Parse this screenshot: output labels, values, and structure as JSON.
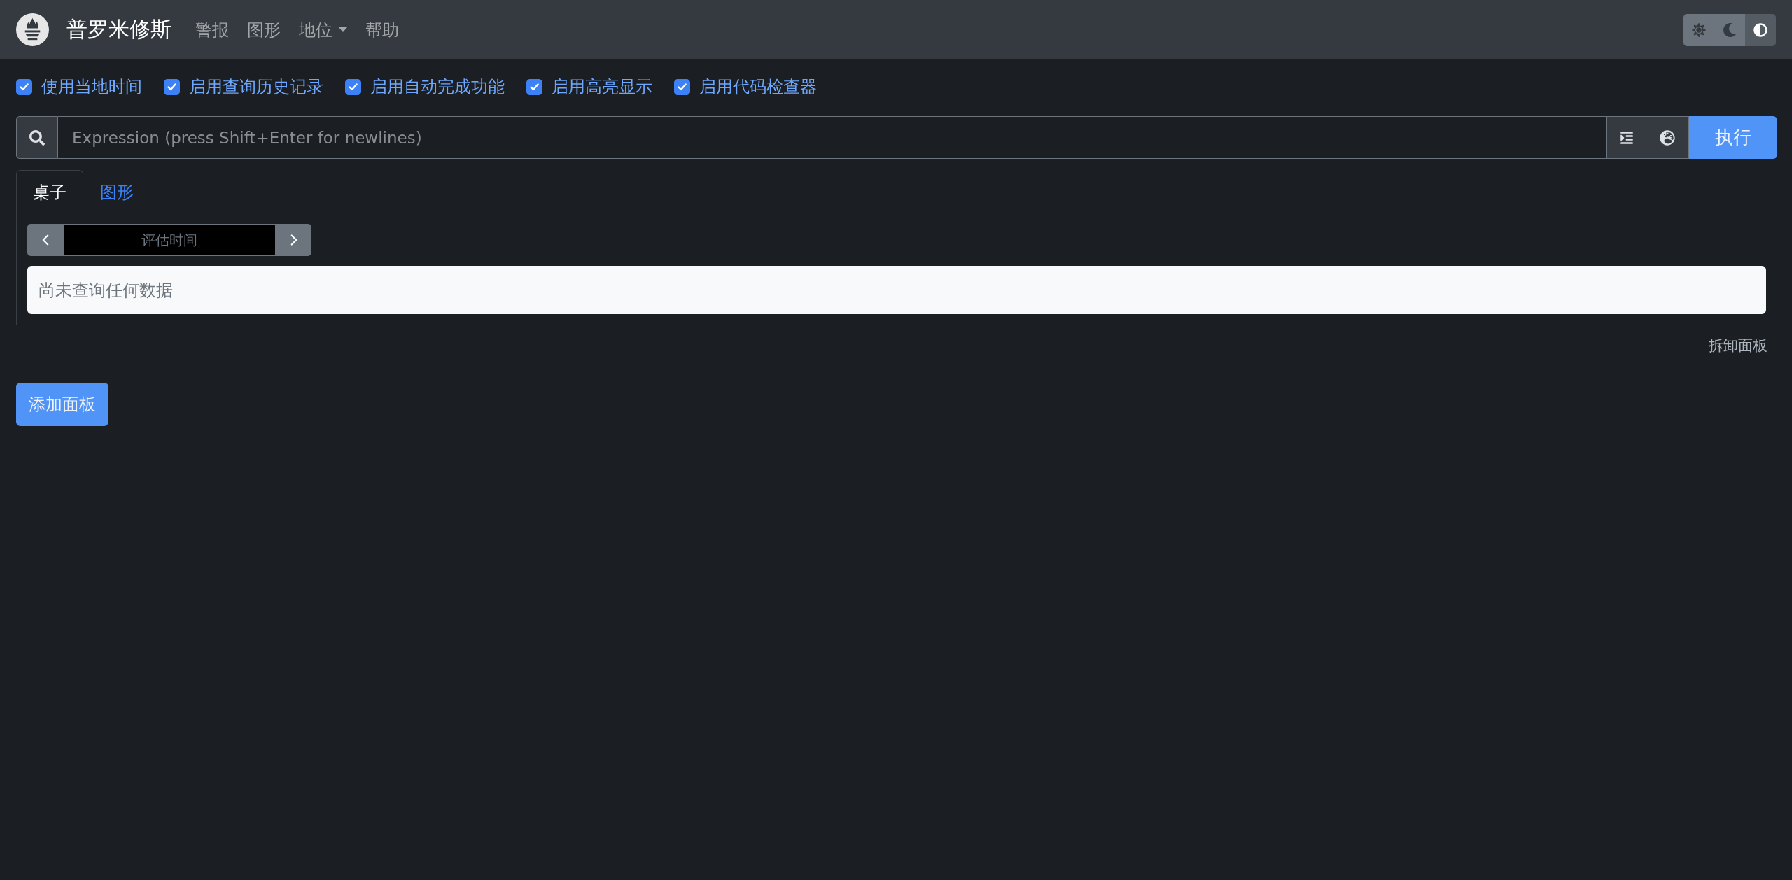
{
  "navbar": {
    "brand": "普罗米修斯",
    "links": [
      {
        "label": "警报",
        "dropdown": false
      },
      {
        "label": "图形",
        "dropdown": false
      },
      {
        "label": "地位",
        "dropdown": true
      },
      {
        "label": "帮助",
        "dropdown": false
      }
    ],
    "theme_toggle": [
      {
        "kind": "light",
        "selected": false
      },
      {
        "kind": "dark",
        "selected": false
      },
      {
        "kind": "auto",
        "selected": true
      }
    ]
  },
  "options": [
    {
      "label": "使用当地时间",
      "checked": true
    },
    {
      "label": "启用查询历史记录",
      "checked": true
    },
    {
      "label": "启用自动完成功能",
      "checked": true
    },
    {
      "label": "启用高亮显示",
      "checked": true
    },
    {
      "label": "启用代码检查器",
      "checked": true
    }
  ],
  "query": {
    "placeholder": "Expression (press Shift+Enter for newlines)",
    "execute_button": "执行"
  },
  "panel": {
    "tabs": [
      {
        "label": "桌子",
        "selected": true
      },
      {
        "label": "图形",
        "selected": false
      }
    ],
    "eval_time": {
      "placeholder": "评估时间"
    },
    "alert": "尚未查询任何数据",
    "remove_link": "拆卸面板"
  },
  "add_panel_button": "添加面板"
}
